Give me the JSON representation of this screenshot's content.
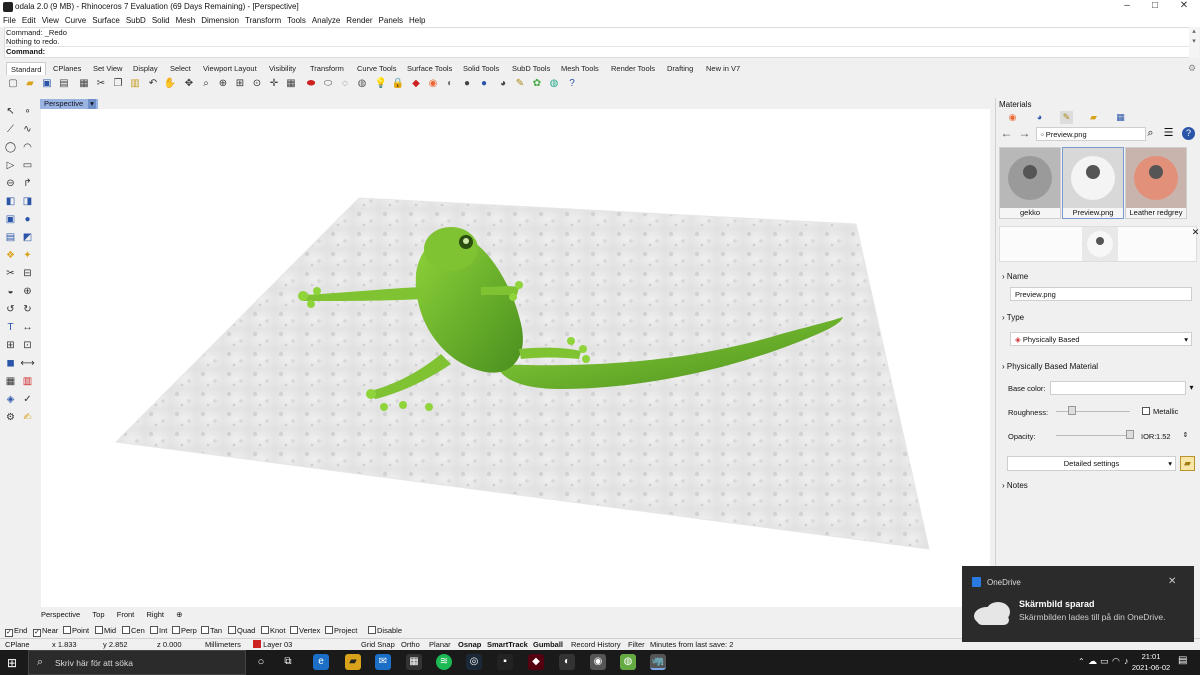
{
  "window": {
    "title": "odala 2.0 (9 MB) - Rhinoceros 7 Evaluation (69 Days Remaining) - [Perspective]",
    "controls": [
      "–",
      "□",
      "✕"
    ]
  },
  "menu": [
    "File",
    "Edit",
    "View",
    "Curve",
    "Surface",
    "SubD",
    "Solid",
    "Mesh",
    "Dimension",
    "Transform",
    "Tools",
    "Analyze",
    "Render",
    "Panels",
    "Help"
  ],
  "command": {
    "history1": "Command: _Redo",
    "history2": "Nothing to redo.",
    "prompt": "Command:"
  },
  "toolbar_tabs": [
    "Standard",
    "CPlanes",
    "Set View",
    "Display",
    "Select",
    "Viewport Layout",
    "Visibility",
    "Transform",
    "Curve Tools",
    "Surface Tools",
    "Solid Tools",
    "SubD Tools",
    "Mesh Tools",
    "Render Tools",
    "Drafting",
    "New in V7"
  ],
  "viewport": {
    "label": "Perspective",
    "dropdown": "▾",
    "bottom_tabs": [
      "Perspective",
      "Top",
      "Front",
      "Right",
      "⊕"
    ]
  },
  "osnaps": [
    {
      "label": "End",
      "checked": true
    },
    {
      "label": "Near",
      "checked": true
    },
    {
      "label": "Point",
      "checked": false
    },
    {
      "label": "Mid",
      "checked": false
    },
    {
      "label": "Cen",
      "checked": false
    },
    {
      "label": "Int",
      "checked": false
    },
    {
      "label": "Perp",
      "checked": false
    },
    {
      "label": "Tan",
      "checked": false
    },
    {
      "label": "Quad",
      "checked": false
    },
    {
      "label": "Knot",
      "checked": false
    },
    {
      "label": "Vertex",
      "checked": false
    },
    {
      "label": "Project",
      "checked": false
    },
    {
      "label": "Disable",
      "checked": false
    }
  ],
  "status": {
    "cplane": "CPlane",
    "x": "x 1.833",
    "y": "y 2.852",
    "z": "z 0.000",
    "units": "Millimeters",
    "layer": "Layer 03",
    "layer_color": "#cc2222",
    "grid_snap": "Grid Snap",
    "ortho": "Ortho",
    "planar": "Planar",
    "osnap": "Osnap",
    "smarttrack": "SmartTrack",
    "gumball": "Gumball",
    "record_history": "Record History",
    "filter": "Filter",
    "save_info": "Minutes from last save: 2"
  },
  "materials": {
    "title": "Materials",
    "breadcrumb": "Preview.png",
    "thumbnails": [
      "gekko",
      "Preview.png",
      "Leather redgrey"
    ],
    "name_section": "Name",
    "name_value": "Preview.png",
    "type_section": "Type",
    "type_value": "Physically Based",
    "pbm_section": "Physically Based Material",
    "base_color_label": "Base color:",
    "roughness_label": "Roughness:",
    "metallic_label": "Metallic",
    "opacity_label": "Opacity:",
    "ior_label": "IOR:",
    "ior_value": "1.52",
    "detailed_button": "Detailed settings",
    "notes_section": "Notes"
  },
  "toast": {
    "app": "OneDrive",
    "title": "Skärmbild sparad",
    "body": "Skärmbilden lades till på din OneDrive."
  },
  "taskbar": {
    "search_placeholder": "Skriv här för att söka",
    "time": "21:01",
    "date": "2021-06-02"
  }
}
